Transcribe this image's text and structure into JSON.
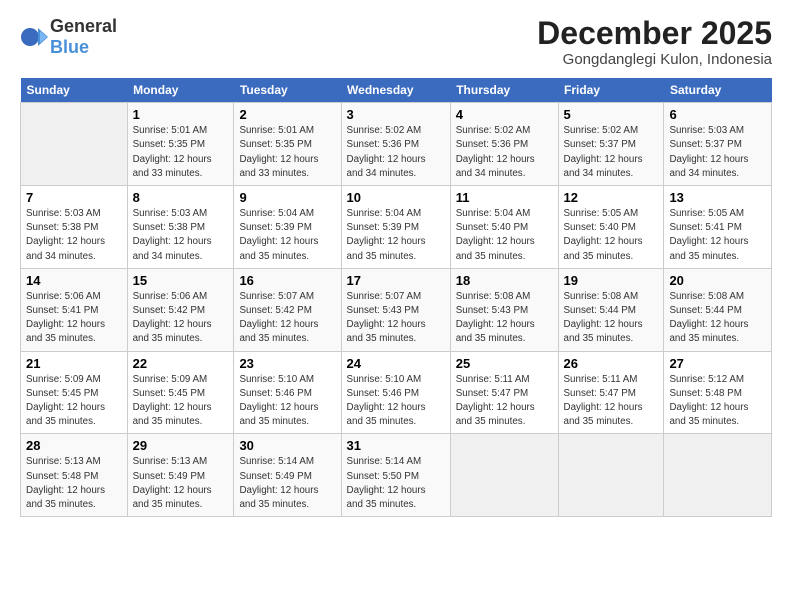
{
  "logo": {
    "general": "General",
    "blue": "Blue"
  },
  "title": {
    "month": "December 2025",
    "location": "Gongdanglegi Kulon, Indonesia"
  },
  "days_header": [
    "Sunday",
    "Monday",
    "Tuesday",
    "Wednesday",
    "Thursday",
    "Friday",
    "Saturday"
  ],
  "weeks": [
    [
      {
        "day": "",
        "info": ""
      },
      {
        "day": "1",
        "info": "Sunrise: 5:01 AM\nSunset: 5:35 PM\nDaylight: 12 hours\nand 33 minutes."
      },
      {
        "day": "2",
        "info": "Sunrise: 5:01 AM\nSunset: 5:35 PM\nDaylight: 12 hours\nand 33 minutes."
      },
      {
        "day": "3",
        "info": "Sunrise: 5:02 AM\nSunset: 5:36 PM\nDaylight: 12 hours\nand 34 minutes."
      },
      {
        "day": "4",
        "info": "Sunrise: 5:02 AM\nSunset: 5:36 PM\nDaylight: 12 hours\nand 34 minutes."
      },
      {
        "day": "5",
        "info": "Sunrise: 5:02 AM\nSunset: 5:37 PM\nDaylight: 12 hours\nand 34 minutes."
      },
      {
        "day": "6",
        "info": "Sunrise: 5:03 AM\nSunset: 5:37 PM\nDaylight: 12 hours\nand 34 minutes."
      }
    ],
    [
      {
        "day": "7",
        "info": "Sunrise: 5:03 AM\nSunset: 5:38 PM\nDaylight: 12 hours\nand 34 minutes."
      },
      {
        "day": "8",
        "info": "Sunrise: 5:03 AM\nSunset: 5:38 PM\nDaylight: 12 hours\nand 34 minutes."
      },
      {
        "day": "9",
        "info": "Sunrise: 5:04 AM\nSunset: 5:39 PM\nDaylight: 12 hours\nand 35 minutes."
      },
      {
        "day": "10",
        "info": "Sunrise: 5:04 AM\nSunset: 5:39 PM\nDaylight: 12 hours\nand 35 minutes."
      },
      {
        "day": "11",
        "info": "Sunrise: 5:04 AM\nSunset: 5:40 PM\nDaylight: 12 hours\nand 35 minutes."
      },
      {
        "day": "12",
        "info": "Sunrise: 5:05 AM\nSunset: 5:40 PM\nDaylight: 12 hours\nand 35 minutes."
      },
      {
        "day": "13",
        "info": "Sunrise: 5:05 AM\nSunset: 5:41 PM\nDaylight: 12 hours\nand 35 minutes."
      }
    ],
    [
      {
        "day": "14",
        "info": "Sunrise: 5:06 AM\nSunset: 5:41 PM\nDaylight: 12 hours\nand 35 minutes."
      },
      {
        "day": "15",
        "info": "Sunrise: 5:06 AM\nSunset: 5:42 PM\nDaylight: 12 hours\nand 35 minutes."
      },
      {
        "day": "16",
        "info": "Sunrise: 5:07 AM\nSunset: 5:42 PM\nDaylight: 12 hours\nand 35 minutes."
      },
      {
        "day": "17",
        "info": "Sunrise: 5:07 AM\nSunset: 5:43 PM\nDaylight: 12 hours\nand 35 minutes."
      },
      {
        "day": "18",
        "info": "Sunrise: 5:08 AM\nSunset: 5:43 PM\nDaylight: 12 hours\nand 35 minutes."
      },
      {
        "day": "19",
        "info": "Sunrise: 5:08 AM\nSunset: 5:44 PM\nDaylight: 12 hours\nand 35 minutes."
      },
      {
        "day": "20",
        "info": "Sunrise: 5:08 AM\nSunset: 5:44 PM\nDaylight: 12 hours\nand 35 minutes."
      }
    ],
    [
      {
        "day": "21",
        "info": "Sunrise: 5:09 AM\nSunset: 5:45 PM\nDaylight: 12 hours\nand 35 minutes."
      },
      {
        "day": "22",
        "info": "Sunrise: 5:09 AM\nSunset: 5:45 PM\nDaylight: 12 hours\nand 35 minutes."
      },
      {
        "day": "23",
        "info": "Sunrise: 5:10 AM\nSunset: 5:46 PM\nDaylight: 12 hours\nand 35 minutes."
      },
      {
        "day": "24",
        "info": "Sunrise: 5:10 AM\nSunset: 5:46 PM\nDaylight: 12 hours\nand 35 minutes."
      },
      {
        "day": "25",
        "info": "Sunrise: 5:11 AM\nSunset: 5:47 PM\nDaylight: 12 hours\nand 35 minutes."
      },
      {
        "day": "26",
        "info": "Sunrise: 5:11 AM\nSunset: 5:47 PM\nDaylight: 12 hours\nand 35 minutes."
      },
      {
        "day": "27",
        "info": "Sunrise: 5:12 AM\nSunset: 5:48 PM\nDaylight: 12 hours\nand 35 minutes."
      }
    ],
    [
      {
        "day": "28",
        "info": "Sunrise: 5:13 AM\nSunset: 5:48 PM\nDaylight: 12 hours\nand 35 minutes."
      },
      {
        "day": "29",
        "info": "Sunrise: 5:13 AM\nSunset: 5:49 PM\nDaylight: 12 hours\nand 35 minutes."
      },
      {
        "day": "30",
        "info": "Sunrise: 5:14 AM\nSunset: 5:49 PM\nDaylight: 12 hours\nand 35 minutes."
      },
      {
        "day": "31",
        "info": "Sunrise: 5:14 AM\nSunset: 5:50 PM\nDaylight: 12 hours\nand 35 minutes."
      },
      {
        "day": "",
        "info": ""
      },
      {
        "day": "",
        "info": ""
      },
      {
        "day": "",
        "info": ""
      }
    ]
  ]
}
